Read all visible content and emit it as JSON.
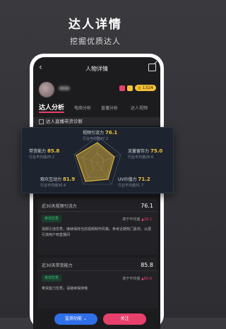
{
  "promo": {
    "title": "达人详情",
    "subtitle": "挖掘优质达人"
  },
  "nav": {
    "back_icon": "‹",
    "title": "人物详情"
  },
  "profile": {
    "coin_value": "1324"
  },
  "tabs": [
    {
      "label": "达人分析"
    },
    {
      "label": "电商分析"
    },
    {
      "label": "直播分析"
    },
    {
      "label": "达人视频"
    }
  ],
  "section_title": "达人直播带货诊断",
  "radar": {
    "metrics": [
      {
        "label": "视频引流力",
        "value": "76.1",
        "avg": "行业平均值47.2"
      },
      {
        "label": "带货能力",
        "value": "85.8",
        "avg": "行业平均值25.2"
      },
      {
        "label": "流量留存力",
        "value": "75.0",
        "avg": "行业平均值26.6"
      },
      {
        "label": "观众互动力",
        "value": "81.9",
        "avg": "行业平均值30.9"
      },
      {
        "label": "UV价值力",
        "value": "71.2",
        "avg": "行业平均值31.7"
      }
    ]
  },
  "cards": {
    "c1": {
      "title": "近30天视频引流力",
      "value": "76.1",
      "tag": "表现优秀",
      "higher": "高于平均值",
      "delta": "▲29.1",
      "desc": "视频引流优秀，继续保持当前视频制作风格，参考近期热门素材，以便引流用户到直播间"
    },
    "c2": {
      "title": "近30天带货能力",
      "value": "85.8",
      "tag": "表现优秀",
      "higher": "高于平均值",
      "delta": "▲60.6",
      "desc": "带货能力优秀，请继续保持哦"
    }
  },
  "buttons": {
    "monitor": "监测功能 ⌄",
    "follow": "关注"
  },
  "colors": {
    "accent": "#e8406c",
    "gold": "#f3c13a",
    "good": "#31c27c",
    "blue": "#2f6fe8"
  }
}
